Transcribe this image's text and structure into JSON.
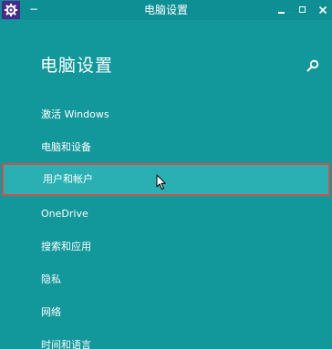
{
  "titlebar": {
    "title": "电脑设置",
    "sys_menu": "−",
    "icon": "gear-icon"
  },
  "page": {
    "heading": "电脑设置",
    "search_icon": "search-icon"
  },
  "menu": {
    "items": [
      {
        "label": "激活 Windows"
      },
      {
        "label": "电脑和设备"
      },
      {
        "label": "用户和帐户",
        "state": "hover"
      },
      {
        "label": "OneDrive"
      },
      {
        "label": "搜索和应用"
      },
      {
        "label": "隐私"
      },
      {
        "label": "网络"
      },
      {
        "label": "时间和语言"
      }
    ]
  },
  "colors": {
    "background": "#12979b",
    "titlebar": "#0d8f93",
    "app_icon_bg": "#4b2a8e",
    "hover_bg": "#2ab0b3",
    "hover_border": "#d2504a",
    "text": "#ffffff"
  }
}
